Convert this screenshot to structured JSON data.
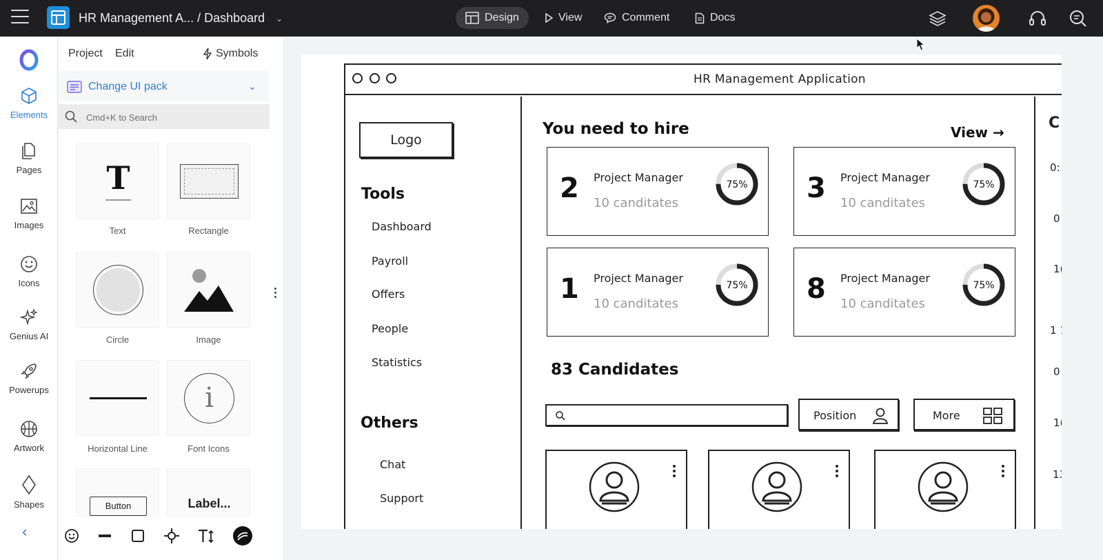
{
  "topbar": {
    "project_title": "HR Management A... / Dashboard",
    "tabs": [
      {
        "label": "Design",
        "icon": "layout-icon",
        "active": true
      },
      {
        "label": "View",
        "icon": "play-icon",
        "active": false
      },
      {
        "label": "Comment",
        "icon": "comment-icon",
        "active": false
      },
      {
        "label": "Docs",
        "icon": "document-icon",
        "active": false
      }
    ],
    "right_icons": [
      "layers-icon",
      "avatar",
      "headset-icon",
      "search-help-icon"
    ]
  },
  "rail": {
    "items": [
      {
        "label": "Elements",
        "icon": "cube-icon",
        "active": true
      },
      {
        "label": "Pages",
        "icon": "pages-icon"
      },
      {
        "label": "Images",
        "icon": "image-icon"
      },
      {
        "label": "Icons",
        "icon": "smiley-icon"
      },
      {
        "label": "Genius AI",
        "icon": "sparkle-icon"
      },
      {
        "label": "Powerups",
        "icon": "rocket-icon"
      },
      {
        "label": "Artwork",
        "icon": "basketball-icon"
      },
      {
        "label": "Shapes",
        "icon": "diamond-icon"
      }
    ]
  },
  "panel": {
    "menu": {
      "project": "Project",
      "edit": "Edit",
      "symbols": "Symbols"
    },
    "ui_pack": "Change UI pack",
    "search_placeholder": "Cmd+K to Search",
    "tiles": [
      {
        "label": "Text",
        "preview": "T"
      },
      {
        "label": "Rectangle"
      },
      {
        "label": "Circle"
      },
      {
        "label": "Image"
      },
      {
        "label": "Horizontal Line"
      },
      {
        "label": "Font Icons",
        "preview": "i"
      },
      {
        "label": "",
        "preview": "Button"
      },
      {
        "label": "",
        "preview": "Label..."
      }
    ],
    "bottom_tools": [
      "smiley-icon",
      "line-icon",
      "square-icon",
      "move-icon",
      "text-size-icon",
      "brand-icon"
    ]
  },
  "wireframe": {
    "window_title": "HR Management Application",
    "logo": "Logo",
    "tools_heading": "Tools",
    "tools": [
      "Dashboard",
      "Payroll",
      "Offers",
      "People",
      "Statistics"
    ],
    "others_heading": "Others",
    "others": [
      "Chat",
      "Support"
    ],
    "hire_heading": "You need to hire",
    "view_link": "View →",
    "hire_cards": [
      {
        "number": "2",
        "role": "Project Manager",
        "count": "10 canditates",
        "percent_label": "75%",
        "percent": 75
      },
      {
        "number": "3",
        "role": "Project Manager",
        "count": "10 canditates",
        "percent_label": "75%",
        "percent": 75
      },
      {
        "number": "1",
        "role": "Project Manager",
        "count": "10 canditates",
        "percent_label": "75%",
        "percent": 75
      },
      {
        "number": "8",
        "role": "Project Manager",
        "count": "10 canditates",
        "percent_label": "75%",
        "percent": 75
      }
    ],
    "candidates_heading": "83 Candidates",
    "position_button": "Position",
    "more_button": "More",
    "right_column": {
      "heading": "C",
      "rows": [
        "0:",
        "0",
        "1(",
        "1 1",
        "0",
        "1(",
        "13"
      ]
    }
  },
  "colors": {
    "accent": "#2f7fd0",
    "topbar": "#1f1f22",
    "app_icon": "#1f8fd8",
    "avatar": "#e3842c"
  }
}
